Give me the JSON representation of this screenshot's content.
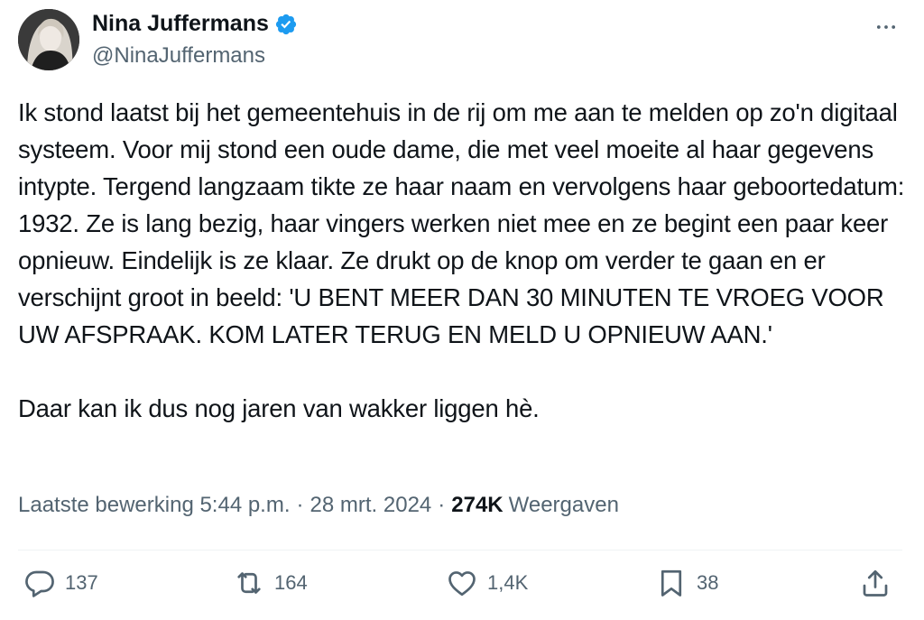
{
  "author": {
    "name": "Nina Juffermans",
    "handle": "@NinaJuffermans"
  },
  "tweet": {
    "text": "Ik stond laatst bij het gemeentehuis in de rij om me aan te melden op zo'n digitaal systeem. Voor mij stond een oude dame, die met veel moeite al haar gegevens intypte. Tergend langzaam tikte ze haar naam en vervolgens haar geboortedatum: 1932. Ze is lang bezig, haar vingers werken niet mee en ze begint een paar keer opnieuw. Eindelijk is ze klaar. Ze drukt op de knop om verder te gaan en er verschijnt groot in beeld: 'U BENT MEER DAN 30 MINUTEN TE VROEG VOOR UW AFSPRAAK. KOM LATER TERUG EN MELD U OPNIEUW AAN.'\n\nDaar kan ik dus nog jaren van wakker liggen hè."
  },
  "meta": {
    "edited_label": "Laatste bewerking 5:44 p.m.",
    "separator": "·",
    "date": "28 mrt. 2024",
    "views_count": "274K",
    "views_label": "Weergaven"
  },
  "actions": {
    "replies": "137",
    "reposts": "164",
    "likes": "1,4K",
    "bookmarks": "38"
  },
  "icons": {
    "verified": "verified-badge-icon",
    "more": "more-horizontal-icon",
    "reply": "reply-icon",
    "repost": "repost-icon",
    "like": "heart-icon",
    "bookmark": "bookmark-icon",
    "share": "share-icon"
  },
  "colors": {
    "text": "#0f1419",
    "secondary": "#536471",
    "verified": "#1d9bf0",
    "divider": "#eff3f4"
  }
}
